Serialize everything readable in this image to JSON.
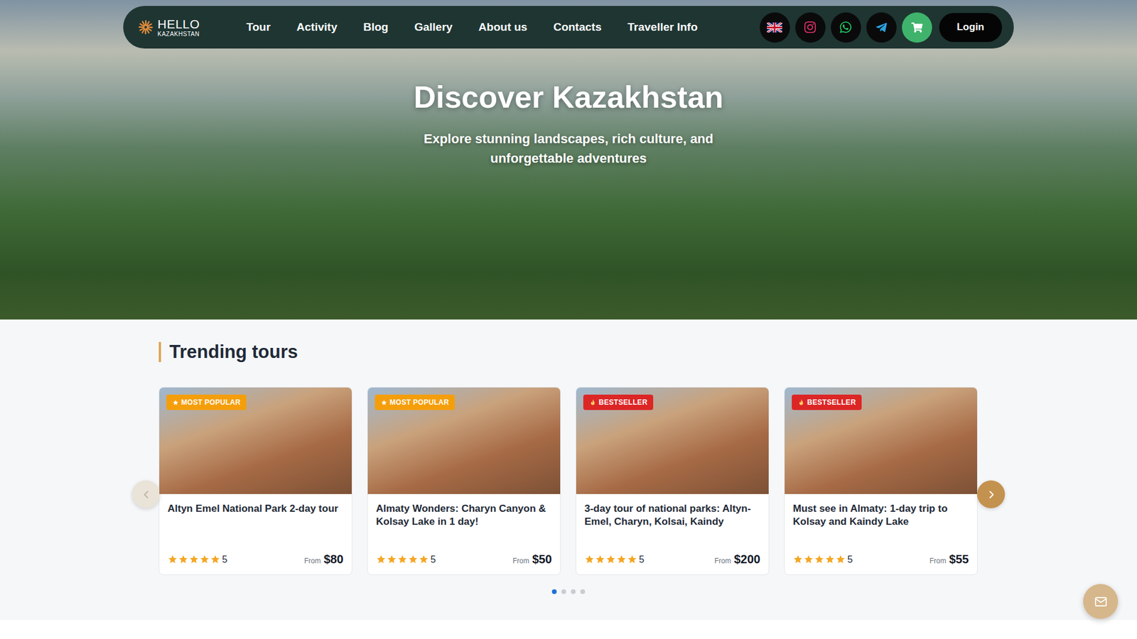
{
  "nav": {
    "logo": {
      "title": "HELLO",
      "subtitle": "KAZAKHSTAN"
    },
    "links": [
      "Tour",
      "Activity",
      "Blog",
      "Gallery",
      "About us",
      "Contacts",
      "Traveller Info"
    ],
    "login": "Login"
  },
  "hero": {
    "title": "Discover Kazakhstan",
    "subtitle": "Explore stunning landscapes, rich culture, and unforgettable adventures"
  },
  "trending": {
    "title": "Trending tours",
    "prev_disabled": true,
    "next_disabled": false,
    "tours": [
      {
        "badge": "MOST POPULAR",
        "kind": "popular",
        "color": "#f59e0b",
        "title": "Altyn Emel National Park 2-day tour",
        "stars": 5,
        "rating": "5",
        "price_prefix": "From",
        "price": "$80"
      },
      {
        "badge": "MOST POPULAR",
        "kind": "popular",
        "color": "#f59e0b",
        "title": "Almaty Wonders: Charyn Canyon & Kolsay Lake in 1 day!",
        "stars": 5,
        "rating": "5",
        "price_prefix": "From",
        "price": "$50"
      },
      {
        "badge": "BESTSELLER",
        "kind": "bestseller",
        "color": "#dc2626",
        "title": "3-day tour of national parks: Altyn-Emel, Charyn, Kolsai, Kaindy",
        "stars": 5,
        "rating": "5",
        "price_prefix": "From",
        "price": "$200"
      },
      {
        "badge": "BESTSELLER",
        "kind": "bestseller",
        "color": "#dc2626",
        "title": "Must see in Almaty: 1-day trip to Kolsay and Kaindy Lake",
        "stars": 5,
        "rating": "5",
        "price_prefix": "From",
        "price": "$55"
      }
    ],
    "pages": [
      {
        "selected": true
      },
      {
        "selected": false
      },
      {
        "selected": false
      },
      {
        "selected": false
      }
    ]
  }
}
